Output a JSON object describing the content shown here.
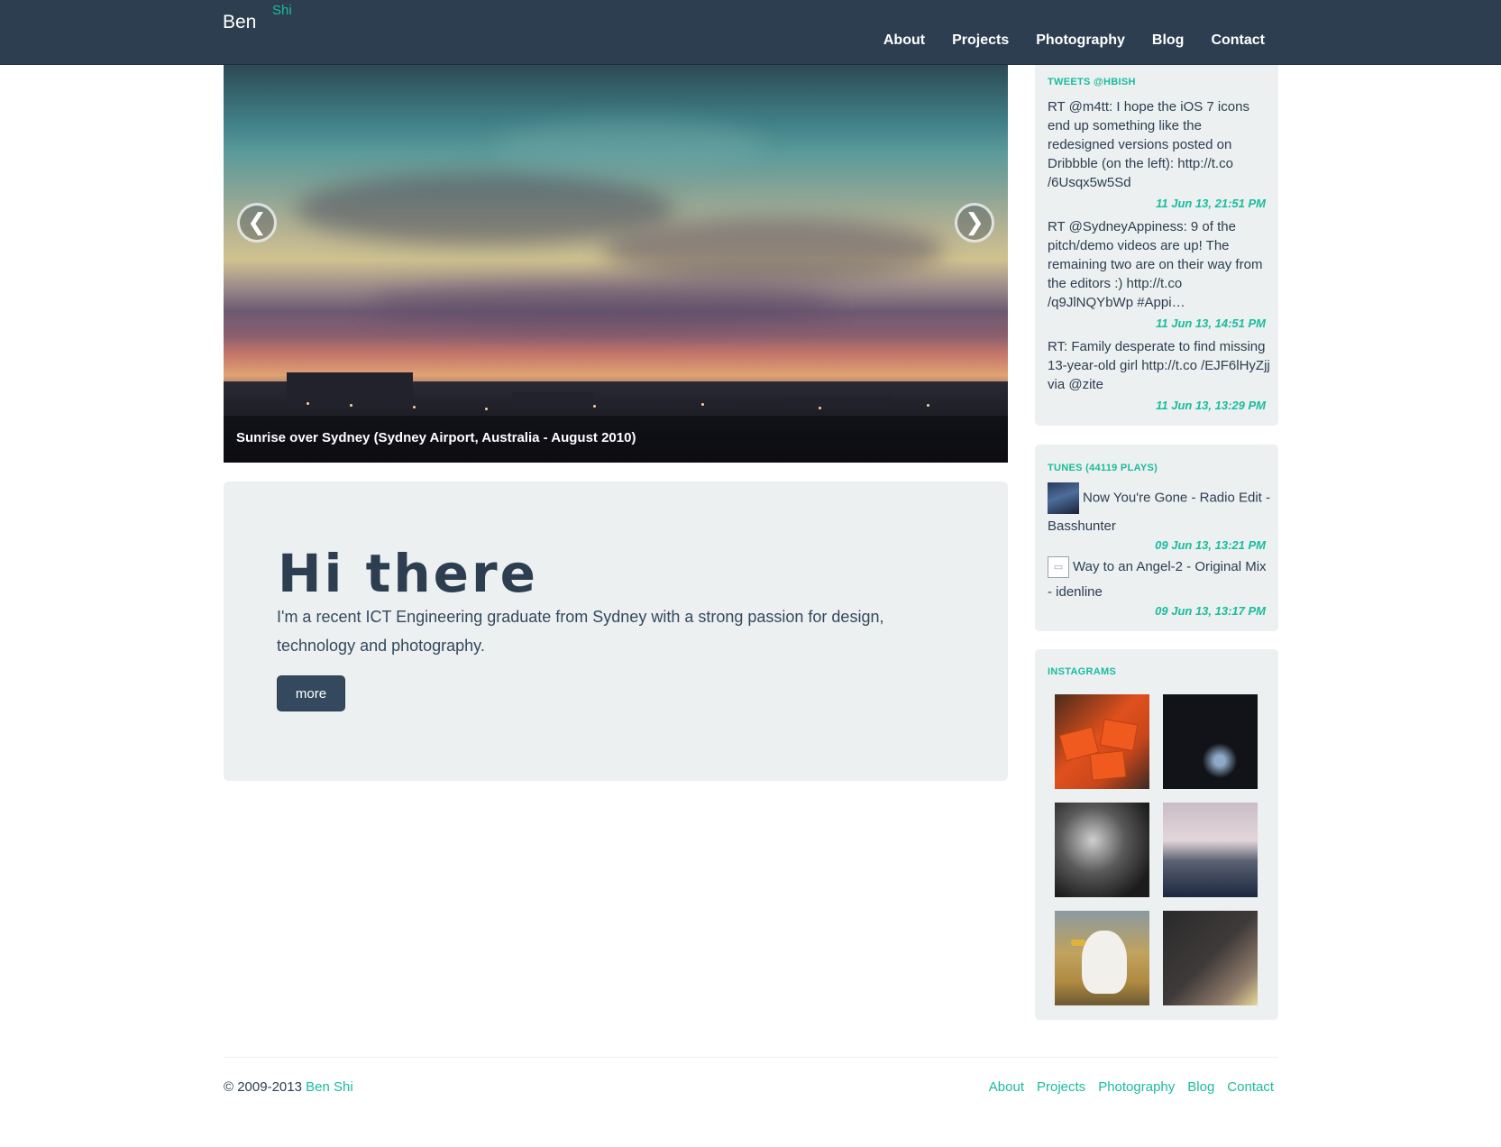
{
  "brand": {
    "first": "Ben",
    "last": "Shi"
  },
  "nav": {
    "items": [
      "About",
      "Projects",
      "Photography",
      "Blog",
      "Contact"
    ]
  },
  "carousel": {
    "caption": "Sunrise over Sydney (Sydney Airport, Australia - August 2010)",
    "prev_icon": "chevron-left-icon",
    "next_icon": "chevron-right-icon",
    "prev_glyph": "❮",
    "next_glyph": "❯"
  },
  "hero": {
    "title": "Hi there",
    "text": "I'm a recent ICT Engineering graduate from Sydney with a strong passion for design, technology and photography.",
    "button": "more"
  },
  "tweets": {
    "heading": "TWEETS @HBISH",
    "items": [
      {
        "text": "RT @m4tt: I hope the iOS 7 icons end up something like the redesigned versions posted on Dribbble (on the left): http://t.co /6Usqx5w5Sd",
        "time": "11 Jun 13, 21:51 PM"
      },
      {
        "text": "RT @SydneyAppiness: 9 of the pitch/demo videos are up! The remaining two are on their way from the editors :) http://t.co /q9JlNQYbWp #Appi…",
        "time": "11 Jun 13, 14:51 PM"
      },
      {
        "text": "RT: Family desperate to find missing 13-year-old girl http://t.co /EJF6lHyZjj via @zite",
        "time": "11 Jun 13, 13:29 PM"
      }
    ]
  },
  "tunes": {
    "heading": "TUNES (44119 PLAYS)",
    "items": [
      {
        "text": "Now You're Gone - Radio Edit - Basshunter",
        "time": "09 Jun 13, 13:21 PM"
      },
      {
        "text": "Way to an Angel-2 - Original Mix - idenline",
        "time": "09 Jun 13, 13:17 PM"
      }
    ]
  },
  "instagrams": {
    "heading": "INSTAGRAMS"
  },
  "footer": {
    "copyright": "© 2009-2013",
    "author": "Ben Shi",
    "links": [
      "About",
      "Projects",
      "Photography",
      "Blog",
      "Contact"
    ]
  },
  "colors": {
    "navbar": "#2c3e50",
    "accent": "#1abc9c",
    "panel": "#ecf0f1",
    "button": "#34495e"
  }
}
